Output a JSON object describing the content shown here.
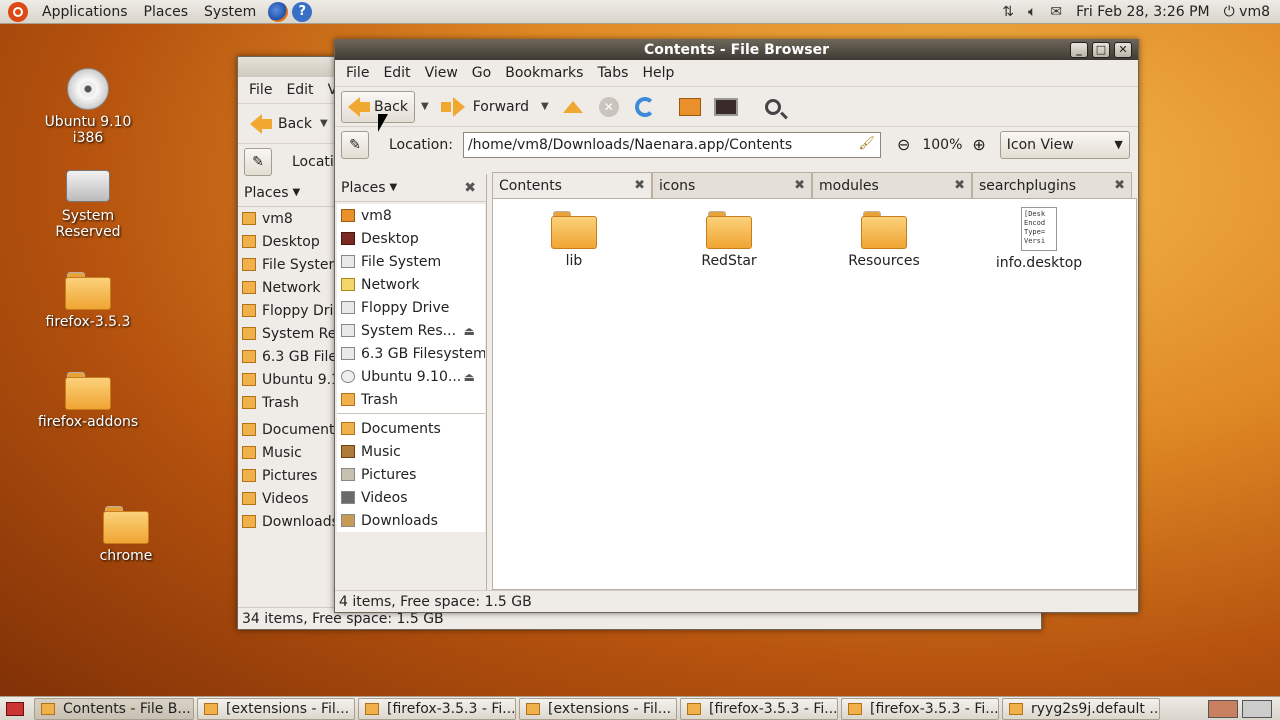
{
  "topbar": {
    "menus": [
      "Applications",
      "Places",
      "System"
    ],
    "clock": "Fri Feb 28,  3:26 PM",
    "user": "vm8"
  },
  "desktop": [
    {
      "label": "Ubuntu 9.10 i386",
      "icon": "cd-icon"
    },
    {
      "label": "System Reserved",
      "icon": "drive-icon"
    },
    {
      "label": "firefox-3.5.3",
      "icon": "folder-icon"
    },
    {
      "label": "firefox-addons",
      "icon": "folder-icon"
    },
    {
      "label": "chrome",
      "icon": "folder-icon"
    }
  ],
  "back_window": {
    "menus": [
      "File",
      "Edit",
      "V"
    ],
    "back_label": "Back",
    "location_label": "Locatio",
    "places_label": "Places",
    "items": [
      "vm8",
      "Desktop",
      "File System",
      "Network",
      "Floppy Driv",
      "System Res",
      "6.3 GB Files",
      "Ubuntu 9.1",
      "Trash",
      "Documents",
      "Music",
      "Pictures",
      "Videos",
      "Downloads"
    ],
    "status": "34 items, Free space: 1.5 GB"
  },
  "main_window": {
    "title": "Contents - File Browser",
    "menus": [
      "File",
      "Edit",
      "View",
      "Go",
      "Bookmarks",
      "Tabs",
      "Help"
    ],
    "toolbar": {
      "back": "Back",
      "forward": "Forward"
    },
    "location": {
      "label": "Location:",
      "value": "/home/vm8/Downloads/Naenara.app/Contents",
      "zoom": "100%",
      "view_mode": "Icon View"
    },
    "sidebar": {
      "title": "Places",
      "items": [
        {
          "label": "vm8",
          "icon": "home"
        },
        {
          "label": "Desktop",
          "icon": "desk"
        },
        {
          "label": "File System",
          "icon": "fs"
        },
        {
          "label": "Network",
          "icon": "net"
        },
        {
          "label": "Floppy Drive",
          "icon": "fs"
        },
        {
          "label": "System Res...",
          "icon": "fs",
          "eject": true
        },
        {
          "label": "6.3 GB Filesystem",
          "icon": "fs"
        },
        {
          "label": "Ubuntu 9.10...",
          "icon": "cd",
          "eject": true
        },
        {
          "label": "Trash",
          "icon": "trash"
        }
      ],
      "bookmarks": [
        {
          "label": "Documents",
          "icon": "folder"
        },
        {
          "label": "Music",
          "icon": "music"
        },
        {
          "label": "Pictures",
          "icon": "pics"
        },
        {
          "label": "Videos",
          "icon": "vids"
        },
        {
          "label": "Downloads",
          "icon": "dl"
        }
      ]
    },
    "tabs": [
      "Contents",
      "icons",
      "modules",
      "searchplugins"
    ],
    "files": [
      {
        "name": "lib",
        "type": "folder"
      },
      {
        "name": "RedStar",
        "type": "folder"
      },
      {
        "name": "Resources",
        "type": "folder"
      },
      {
        "name": "info.desktop",
        "type": "file",
        "preview": "[Desk\nEncod\nType=\nVersi"
      }
    ],
    "status": "4 items, Free space: 1.5 GB"
  },
  "taskbar": [
    {
      "label": "Contents - File B...",
      "active": true
    },
    {
      "label": "[extensions - Fil..."
    },
    {
      "label": "[firefox-3.5.3 - Fi..."
    },
    {
      "label": "[extensions - Fil..."
    },
    {
      "label": "[firefox-3.5.3 - Fi..."
    },
    {
      "label": "[firefox-3.5.3 - Fi..."
    },
    {
      "label": "ryyg2s9j.default ..."
    }
  ]
}
